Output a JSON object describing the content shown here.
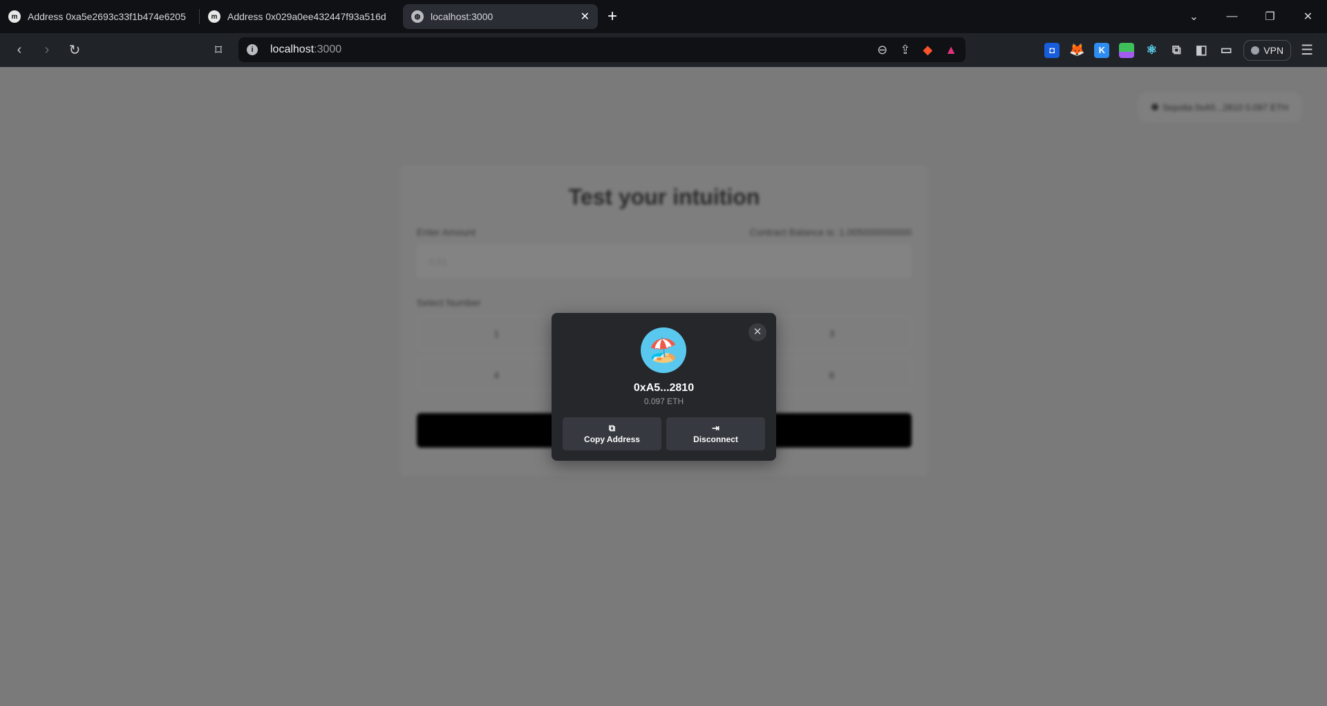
{
  "browser": {
    "tabs": [
      {
        "title": "Address 0xa5e2693c33f1b474e6205",
        "icon": "etherscan-icon"
      },
      {
        "title": "Address 0x029a0ee432447f93a516d",
        "icon": "etherscan-icon"
      },
      {
        "title": "localhost:3000",
        "icon": "globe-icon",
        "active": true
      }
    ],
    "url_host": "localhost",
    "url_port": ":3000",
    "vpn_label": "VPN",
    "extensions": [
      "bitwarden-icon",
      "metamask-icon",
      "k-extension-icon",
      "frog-icon",
      "react-devtools-icon",
      "extensions-icon",
      "sidebar-icon",
      "wallet-icon"
    ]
  },
  "page": {
    "network_badge": "Sepolia 0xA5...2810 0.097 ETH",
    "title": "Test your intuition",
    "amount_label": "Enter Amount",
    "contract_balance": "Contract Balance is: 1.005000000000",
    "amount_placeholder": "0.01",
    "select_label": "Select Number",
    "numbers": [
      "1",
      "",
      "3",
      "4",
      "",
      "6"
    ]
  },
  "modal": {
    "avatar_emoji": "🏖️",
    "address": "0xA5...2810",
    "balance": "0.097 ETH",
    "copy_label": "Copy Address",
    "disconnect_label": "Disconnect",
    "colors": {
      "bg": "#25272b",
      "button": "#36393f",
      "avatar": "#5ac8ee"
    }
  }
}
